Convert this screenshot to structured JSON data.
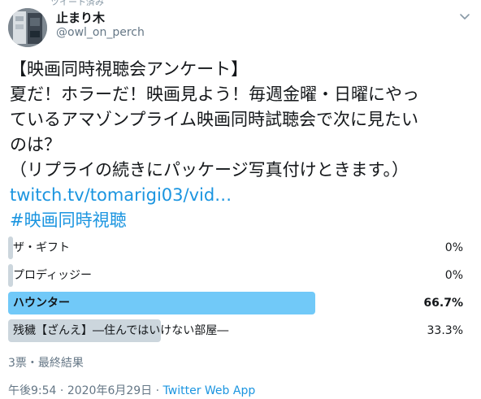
{
  "header": {
    "top_cut_text": "ツイート済み",
    "display_name": "止まり木",
    "handle": "@owl_on_perch"
  },
  "icons": {
    "avatar": "avatar-image",
    "caret": "chevron-down-icon"
  },
  "tweet": {
    "lines": [
      "【映画同時視聴会アンケート】",
      "夏だ！ホラーだ！映画見よう！毎週金曜・日曜にやっ",
      "ているアマゾンプライム映画同時試聴会で次に見たい",
      "のは？",
      "（リプライの続きにパッケージ写真付けときます。）"
    ],
    "link_text": "twitch.tv/tomarigi03/vid…",
    "hashtag": "#映画同時視聴"
  },
  "poll": {
    "options": [
      {
        "label": "ザ・ギフト",
        "percent_text": "0%",
        "percent": 0,
        "winner": false
      },
      {
        "label": "プロディッジー",
        "percent_text": "0%",
        "percent": 0,
        "winner": false
      },
      {
        "label": "ハウンター",
        "percent_text": "66.7%",
        "percent": 66.7,
        "winner": true
      },
      {
        "label": "残穢【ざんえ】―住んではいけない部屋―",
        "percent_text": "33.3%",
        "percent": 33.3,
        "winner": false
      }
    ],
    "meta": "3票・最終結果"
  },
  "footer": {
    "time": "午後9:54",
    "separator1": " · ",
    "date": "2020年6月29日",
    "separator2": " · ",
    "source": "Twitter Web App"
  },
  "colors": {
    "winner_bar": "#71c9f8",
    "loser_bar": "#ccd6dd",
    "link": "#1b95e0",
    "muted": "#657786"
  }
}
